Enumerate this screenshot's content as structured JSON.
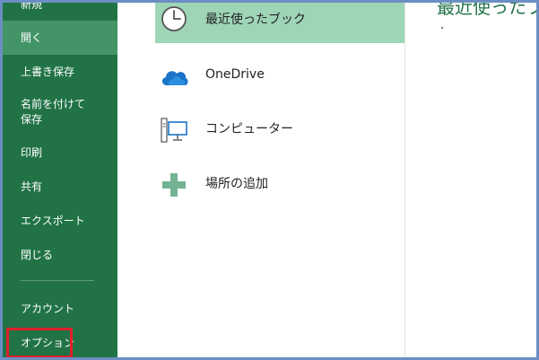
{
  "sidebar": {
    "items": [
      {
        "label": "新規"
      },
      {
        "label": "開く"
      },
      {
        "label": "上書き保存"
      },
      {
        "label_line1": "名前を付けて",
        "label_line2": "保存"
      },
      {
        "label": "印刷"
      },
      {
        "label": "共有"
      },
      {
        "label": "エクスポート"
      },
      {
        "label": "閉じる"
      },
      {
        "label": "アカウント"
      },
      {
        "label": "オプション"
      }
    ]
  },
  "locations": [
    {
      "label": "最近使ったブック",
      "icon": "clock-icon"
    },
    {
      "label": "OneDrive",
      "icon": "onedrive-cloud-icon"
    },
    {
      "label": "コンピューター",
      "icon": "computer-icon"
    },
    {
      "label": "場所の追加",
      "icon": "plus-icon"
    }
  ],
  "right_panel": {
    "title": "最近使ったブ"
  },
  "colors": {
    "sidebar_bg": "#217346",
    "sidebar_active": "#439467",
    "selected_location": "#9fd5b7",
    "accent_green": "#217346",
    "highlight_red": "#e0202a",
    "frame_border": "#6b8fc4"
  }
}
